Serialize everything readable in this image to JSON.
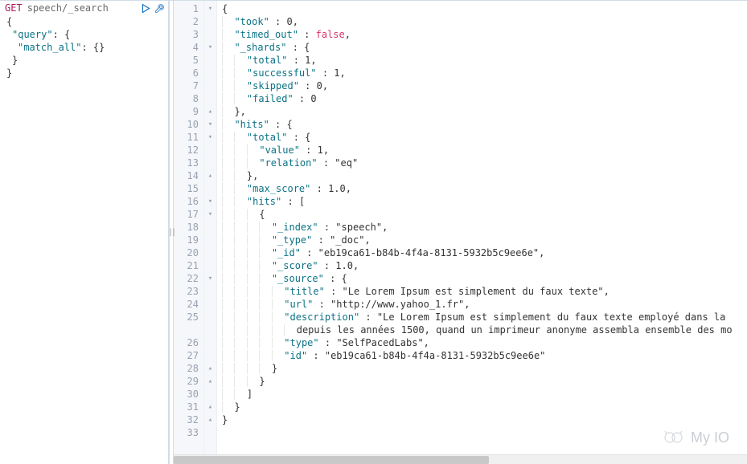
{
  "request": {
    "method": "GET",
    "path": "speech/_search",
    "body_lines": [
      "{",
      "  \"query\": {",
      "    \"match_all\": {}",
      "  }",
      "}"
    ]
  },
  "response_lines": [
    {
      "n": 1,
      "fold": "▾",
      "t": "{"
    },
    {
      "n": 2,
      "fold": "",
      "t": "  \"took\" : 0,"
    },
    {
      "n": 3,
      "fold": "",
      "t": "  \"timed_out\" : false,"
    },
    {
      "n": 4,
      "fold": "▾",
      "t": "  \"_shards\" : {"
    },
    {
      "n": 5,
      "fold": "",
      "t": "    \"total\" : 1,"
    },
    {
      "n": 6,
      "fold": "",
      "t": "    \"successful\" : 1,"
    },
    {
      "n": 7,
      "fold": "",
      "t": "    \"skipped\" : 0,"
    },
    {
      "n": 8,
      "fold": "",
      "t": "    \"failed\" : 0"
    },
    {
      "n": 9,
      "fold": "▴",
      "t": "  },"
    },
    {
      "n": 10,
      "fold": "▾",
      "t": "  \"hits\" : {"
    },
    {
      "n": 11,
      "fold": "▾",
      "t": "    \"total\" : {"
    },
    {
      "n": 12,
      "fold": "",
      "t": "      \"value\" : 1,"
    },
    {
      "n": 13,
      "fold": "",
      "t": "      \"relation\" : \"eq\""
    },
    {
      "n": 14,
      "fold": "▴",
      "t": "    },"
    },
    {
      "n": 15,
      "fold": "",
      "t": "    \"max_score\" : 1.0,"
    },
    {
      "n": 16,
      "fold": "▾",
      "t": "    \"hits\" : ["
    },
    {
      "n": 17,
      "fold": "▾",
      "t": "      {"
    },
    {
      "n": 18,
      "fold": "",
      "t": "        \"_index\" : \"speech\","
    },
    {
      "n": 19,
      "fold": "",
      "t": "        \"_type\" : \"_doc\","
    },
    {
      "n": 20,
      "fold": "",
      "t": "        \"_id\" : \"eb19ca61-b84b-4f4a-8131-5932b5c9ee6e\","
    },
    {
      "n": 21,
      "fold": "",
      "t": "        \"_score\" : 1.0,"
    },
    {
      "n": 22,
      "fold": "▾",
      "t": "        \"_source\" : {"
    },
    {
      "n": 23,
      "fold": "",
      "t": "          \"title\" : \"Le Lorem Ipsum est simplement du faux texte\","
    },
    {
      "n": 24,
      "fold": "",
      "t": "          \"url\" : \"http://www.yahoo_1.fr\","
    },
    {
      "n": 25,
      "fold": "",
      "t": "          \"description\" : \"Le Lorem Ipsum est simplement du faux texte employé dans la\n            depuis les années 1500, quand un imprimeur anonyme assembla ensemble des mo"
    },
    {
      "n": 26,
      "fold": "",
      "t": "          \"type\" : \"SelfPacedLabs\","
    },
    {
      "n": 27,
      "fold": "",
      "t": "          \"id\" : \"eb19ca61-b84b-4f4a-8131-5932b5c9ee6e\""
    },
    {
      "n": 28,
      "fold": "▴",
      "t": "        }"
    },
    {
      "n": 29,
      "fold": "▴",
      "t": "      }"
    },
    {
      "n": 30,
      "fold": "",
      "t": "    ]"
    },
    {
      "n": 31,
      "fold": "▴",
      "t": "  }"
    },
    {
      "n": 32,
      "fold": "▴",
      "t": "}"
    },
    {
      "n": 33,
      "fold": "",
      "t": ""
    }
  ],
  "watermark": "My IO"
}
